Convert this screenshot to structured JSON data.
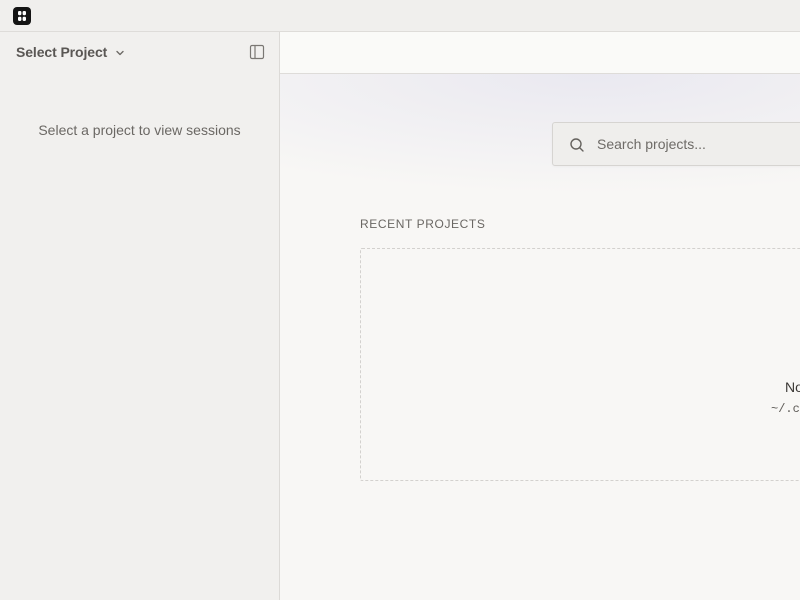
{
  "app": {
    "logo_icon": "app-logo-icon"
  },
  "sidebar": {
    "project_select_label": "Select Project",
    "project_select_icon": "chevron-down-icon",
    "toggle_icon": "sidebar-panel-icon",
    "empty_message": "Select a project to view sessions"
  },
  "main": {
    "search": {
      "placeholder": "Search projects...",
      "value": "",
      "icon": "search-icon"
    },
    "recent_projects": {
      "title": "RECENT PROJECTS",
      "empty_title": "No",
      "empty_path": "~/.c"
    }
  },
  "colors": {
    "titlebar_bg": "#f0efed",
    "sidebar_bg": "#f1f0ee",
    "main_bg": "#f8f7f5",
    "logo_bg": "#141414",
    "border": "#dcdad7"
  }
}
